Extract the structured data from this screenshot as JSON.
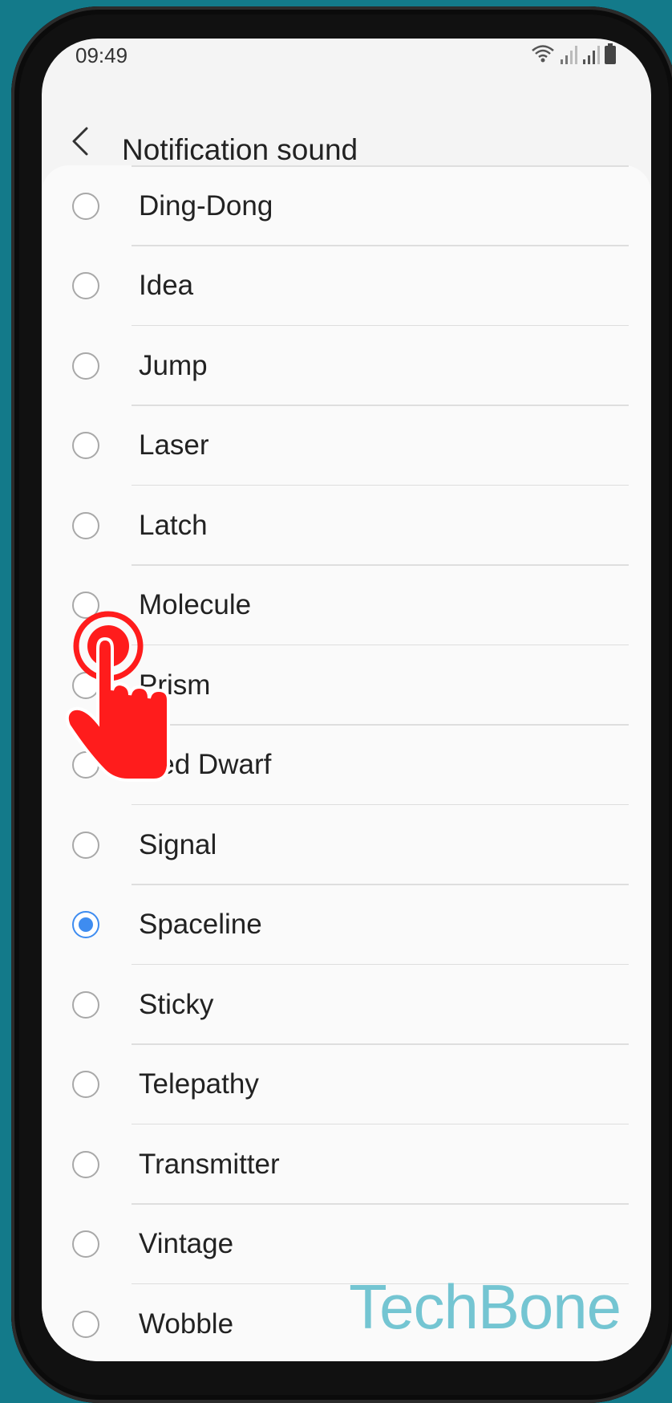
{
  "status_bar": {
    "time": "09:49"
  },
  "header": {
    "title": "Notification sound",
    "back_icon": "chevron-left-icon"
  },
  "sounds": [
    {
      "label": "Ding-Dong",
      "selected": false
    },
    {
      "label": "Idea",
      "selected": false
    },
    {
      "label": "Jump",
      "selected": false
    },
    {
      "label": "Laser",
      "selected": false
    },
    {
      "label": "Latch",
      "selected": false
    },
    {
      "label": "Molecule",
      "selected": false
    },
    {
      "label": "Prism",
      "selected": false
    },
    {
      "label": "Red Dwarf",
      "selected": false
    },
    {
      "label": "Signal",
      "selected": false
    },
    {
      "label": "Spaceline",
      "selected": true
    },
    {
      "label": "Sticky",
      "selected": false
    },
    {
      "label": "Telepathy",
      "selected": false
    },
    {
      "label": "Transmitter",
      "selected": false
    },
    {
      "label": "Vintage",
      "selected": false
    },
    {
      "label": "Wobble",
      "selected": false
    }
  ],
  "watermark": "TechBone",
  "colors": {
    "accent": "#3e8cf0",
    "background": "#137a8a",
    "tap_indicator": "#ff1c1c",
    "watermark": "#74c5d2"
  }
}
